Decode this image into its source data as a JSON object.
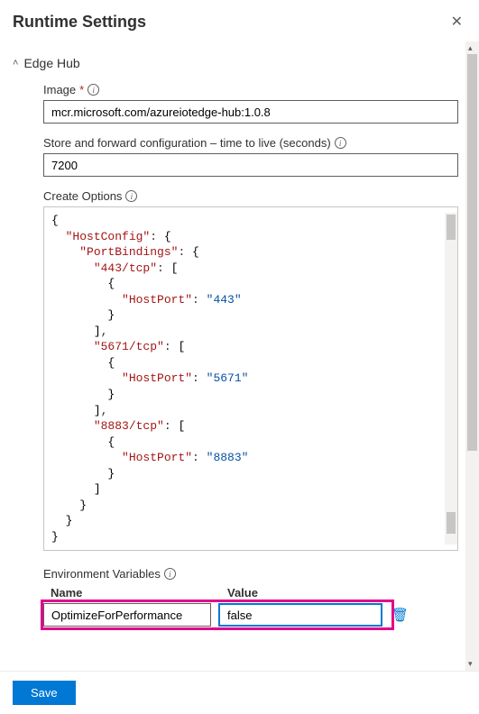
{
  "header": {
    "title": "Runtime Settings"
  },
  "section": {
    "title": "Edge Hub"
  },
  "fields": {
    "image": {
      "label": "Image",
      "value": "mcr.microsoft.com/azureiotedge-hub:1.0.8"
    },
    "ttl": {
      "label": "Store and forward configuration – time to live (seconds)",
      "value": "7200"
    },
    "createOptions": {
      "label": "Create Options",
      "json": {
        "HostConfig": {
          "PortBindings": {
            "443/tcp": [
              {
                "HostPort": "443"
              }
            ],
            "5671/tcp": [
              {
                "HostPort": "5671"
              }
            ],
            "8883/tcp": [
              {
                "HostPort": "8883"
              }
            ]
          }
        }
      }
    }
  },
  "envVars": {
    "label": "Environment Variables",
    "columns": {
      "name": "Name",
      "value": "Value"
    },
    "rows": [
      {
        "name": "OptimizeForPerformance",
        "value": "false"
      }
    ]
  },
  "footer": {
    "save": "Save"
  }
}
